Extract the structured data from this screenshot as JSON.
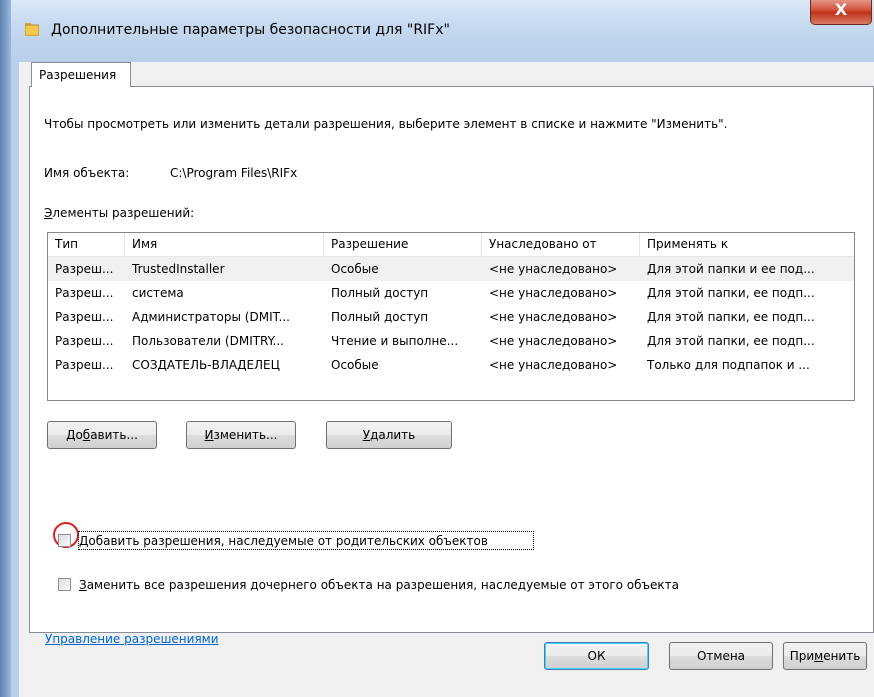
{
  "window": {
    "title": "Дополнительные параметры безопасности  для \"RIFx\"",
    "close_label": "X"
  },
  "tab": {
    "label": "Разрешения"
  },
  "instruction": "Чтобы просмотреть или изменить детали разрешения, выберите элемент в списке и нажмите \"Изменить\".",
  "object": {
    "label": "Имя объекта:",
    "value": "C:\\Program Files\\RIFx"
  },
  "entries": {
    "label": "Элементы разрешений:",
    "columns": [
      "Тип",
      "Имя",
      "Разрешение",
      "Унаследовано от",
      "Применять к"
    ],
    "rows": [
      [
        "Разреш...",
        "TrustedInstaller",
        "Особые",
        "<не унаследовано>",
        "Для этой папки и ее под..."
      ],
      [
        "Разреш...",
        "система",
        "Полный доступ",
        "<не унаследовано>",
        "Для этой папки, ее подп..."
      ],
      [
        "Разреш...",
        "Администраторы (DMIT...",
        "Полный доступ",
        "<не унаследовано>",
        "Для этой папки, ее подп..."
      ],
      [
        "Разреш...",
        "Пользователи (DMITRY...",
        "Чтение и выполне...",
        "<не унаследовано>",
        "Для этой папки, ее подп..."
      ],
      [
        "Разреш...",
        "СОЗДАТЕЛЬ-ВЛАДЕЛЕЦ",
        "Особые",
        "<не унаследовано>",
        "Только для подпапок и ..."
      ]
    ]
  },
  "buttons": {
    "add": "Добавить...",
    "edit": "Изменить...",
    "remove": "Удалить",
    "ok": "ОК",
    "cancel": "Отмена",
    "apply": "Применить"
  },
  "checkboxes": {
    "inherit": {
      "label": "Добавить разрешения, наследуемые от родительских объектов",
      "checked": false
    },
    "replace": {
      "label": "Заменить все разрешения дочернего объекта на разрешения, наследуемые от этого объекта",
      "checked": false
    }
  },
  "manage_link": "Управление разрешениями",
  "colors": {
    "annotation_circle": "#d61f1f",
    "link": "#0066cc",
    "close_button": "#c1331d"
  }
}
